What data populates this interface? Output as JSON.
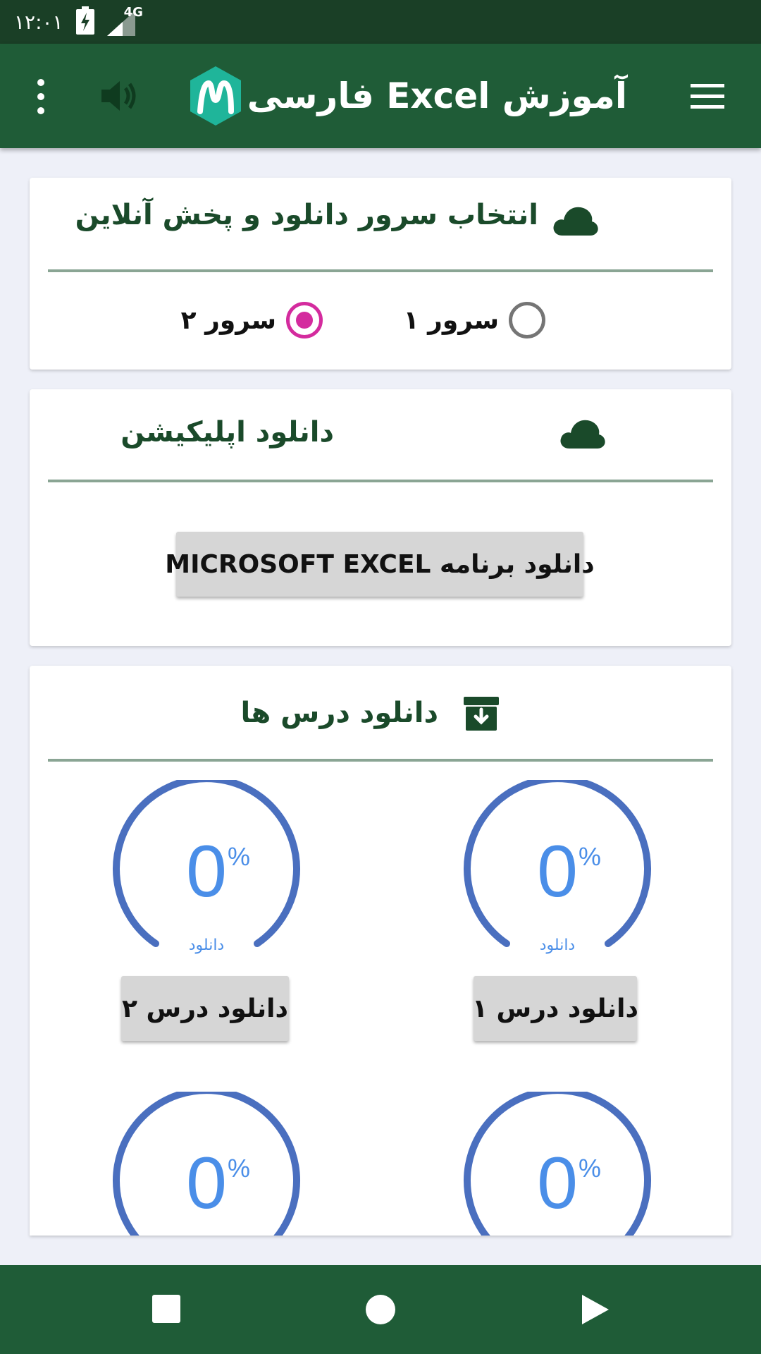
{
  "status_bar": {
    "time": "۱۲:۰۱",
    "network": "4G"
  },
  "app_bar": {
    "title": "آموزش Excel فارسی"
  },
  "server_card": {
    "title": "انتخاب سرور دانلود و پخش آنلاین",
    "options": [
      {
        "label": "سرور ۱",
        "checked": false
      },
      {
        "label": "سرور ۲",
        "checked": true
      }
    ]
  },
  "app_card": {
    "title": "دانلود اپلیکیشن",
    "button_label": "دانلود برنامه MICROSOFT EXCEL"
  },
  "lessons_card": {
    "title": "دانلود درس ها",
    "lessons": [
      {
        "progress": "0",
        "percent_sign": "%",
        "caption": "دانلود",
        "button_label": "دانلود درس ۱"
      },
      {
        "progress": "0",
        "percent_sign": "%",
        "caption": "دانلود",
        "button_label": "دانلود درس ۲"
      },
      {
        "progress": "0",
        "percent_sign": "%"
      },
      {
        "progress": "0",
        "percent_sign": "%"
      }
    ]
  },
  "colors": {
    "app_bar": "#1f5c37",
    "status_bar": "#1a3f26",
    "accent": "#d42b9e",
    "gauge_arc": "#4a6fbf",
    "gauge_text": "#4a8ee8"
  }
}
